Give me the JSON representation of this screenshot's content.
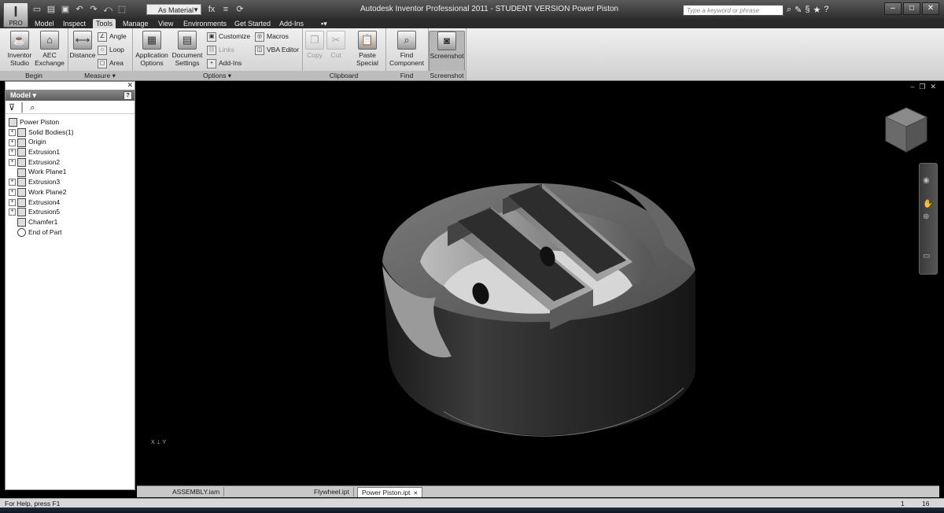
{
  "app": {
    "title": "Autodesk Inventor Professional 2011 - STUDENT VERSION   Power Piston",
    "logo_sub": "PRO"
  },
  "qat": {
    "material": "As Material",
    "search_placeholder": "Type a keyword or phrase"
  },
  "tabs": [
    {
      "label": "Model"
    },
    {
      "label": "Inspect"
    },
    {
      "label": "Tools"
    },
    {
      "label": "Manage"
    },
    {
      "label": "View"
    },
    {
      "label": "Environments"
    },
    {
      "label": "Get Started"
    },
    {
      "label": "Add-Ins"
    }
  ],
  "ribbon": {
    "begin": {
      "title": "Begin",
      "inventor_studio": "Inventor Studio",
      "aec_exchange": "AEC Exchange"
    },
    "measure": {
      "title": "Measure",
      "distance": "Distance",
      "angle": "Angle",
      "loop": "Loop",
      "area": "Area"
    },
    "options": {
      "title": "Options",
      "application_options": "Application Options",
      "document_settings": "Document Settings",
      "customize": "Customize",
      "links": "Links",
      "add_ins": "Add-Ins",
      "macros": "Macros",
      "vba_editor": "VBA Editor"
    },
    "clipboard": {
      "title": "Clipboard",
      "copy": "Copy",
      "cut": "Cut",
      "paste_special": "Paste Special"
    },
    "find": {
      "title": "Find",
      "find_component": "Find Component"
    },
    "screenshot": {
      "title": "Screenshot",
      "screenshot": "Screenshot"
    }
  },
  "browser": {
    "title": "Model",
    "tree": [
      {
        "label": "Power Piston",
        "expandable": false,
        "root": true
      },
      {
        "label": "Solid Bodies(1)",
        "expandable": true
      },
      {
        "label": "Origin",
        "expandable": true
      },
      {
        "label": "Extrusion1",
        "expandable": true
      },
      {
        "label": "Extrusion2",
        "expandable": true
      },
      {
        "label": "Work Plane1",
        "expandable": false
      },
      {
        "label": "Extrusion3",
        "expandable": true
      },
      {
        "label": "Work Plane2",
        "expandable": true
      },
      {
        "label": "Extrusion4",
        "expandable": true
      },
      {
        "label": "Extrusion5",
        "expandable": true
      },
      {
        "label": "Chamfer1",
        "expandable": false
      },
      {
        "label": "End of Part",
        "expandable": false,
        "end": true
      }
    ]
  },
  "doc_tabs": [
    {
      "label": "ASSEMBLY.iam",
      "active": false
    },
    {
      "label": "Flywheel.ipt",
      "active": false
    },
    {
      "label": "Power Piston.ipt",
      "active": true
    }
  ],
  "status": {
    "help_text": "For Help, press F1",
    "value1": "1",
    "value2": "16"
  },
  "triad": {
    "x": "X",
    "y": "Y"
  }
}
